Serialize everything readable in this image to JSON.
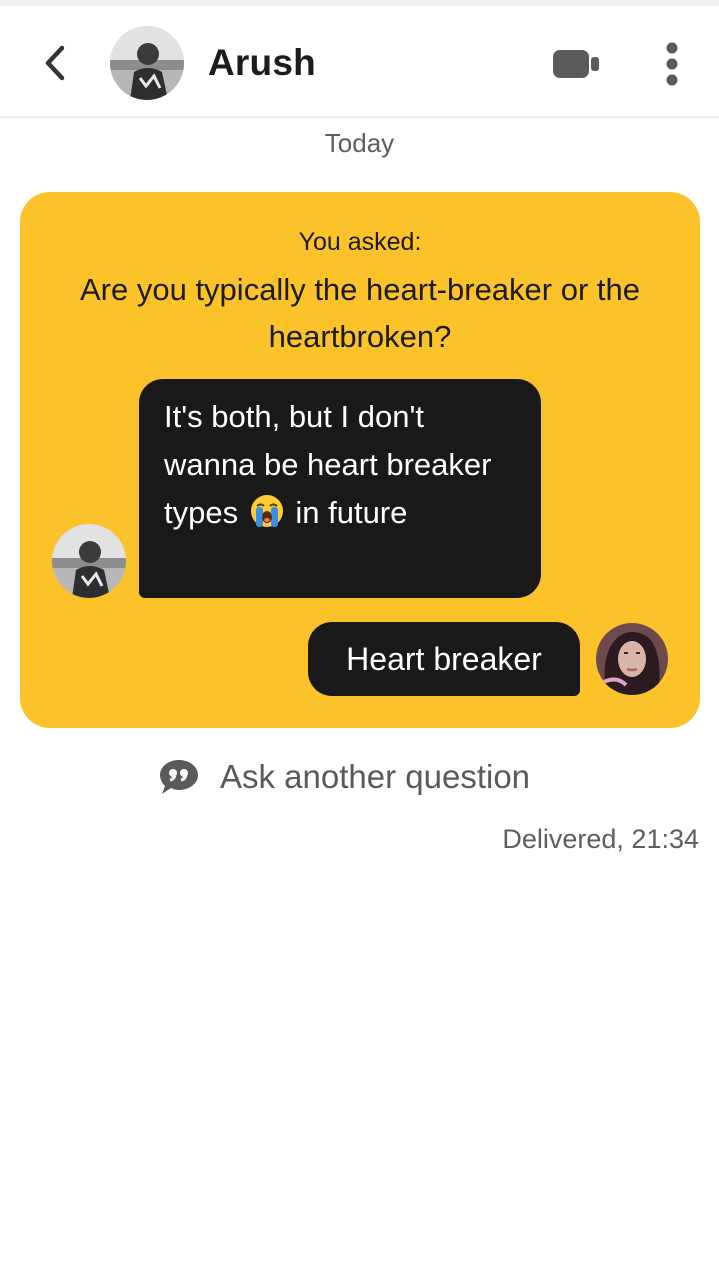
{
  "header": {
    "contact_name": "Arush",
    "back_icon": "chevron-left-icon",
    "video_icon": "video-camera-icon",
    "more_icon": "more-vertical-icon"
  },
  "conversation": {
    "date_label": "Today",
    "question_game": {
      "asked_label": "You asked:",
      "question": "Are you typically the heart-breaker or the heartbroken?",
      "incoming_answer": {
        "text_before_emoji": "It's both, but I don't wanna be heart breaker types",
        "emoji": "loudly-crying-face",
        "text_after_emoji": "in future"
      },
      "outgoing_answer": "Heart breaker"
    },
    "ask_another_label": "Ask another question",
    "ask_another_icon": "speech-bubble-quote-icon",
    "status": "Delivered, 21:34"
  },
  "colors": {
    "card_yellow": "#fcc22a",
    "bubble_dark": "#191919",
    "text_dark": "#1c1c1c",
    "text_muted": "#5e5e5e"
  }
}
